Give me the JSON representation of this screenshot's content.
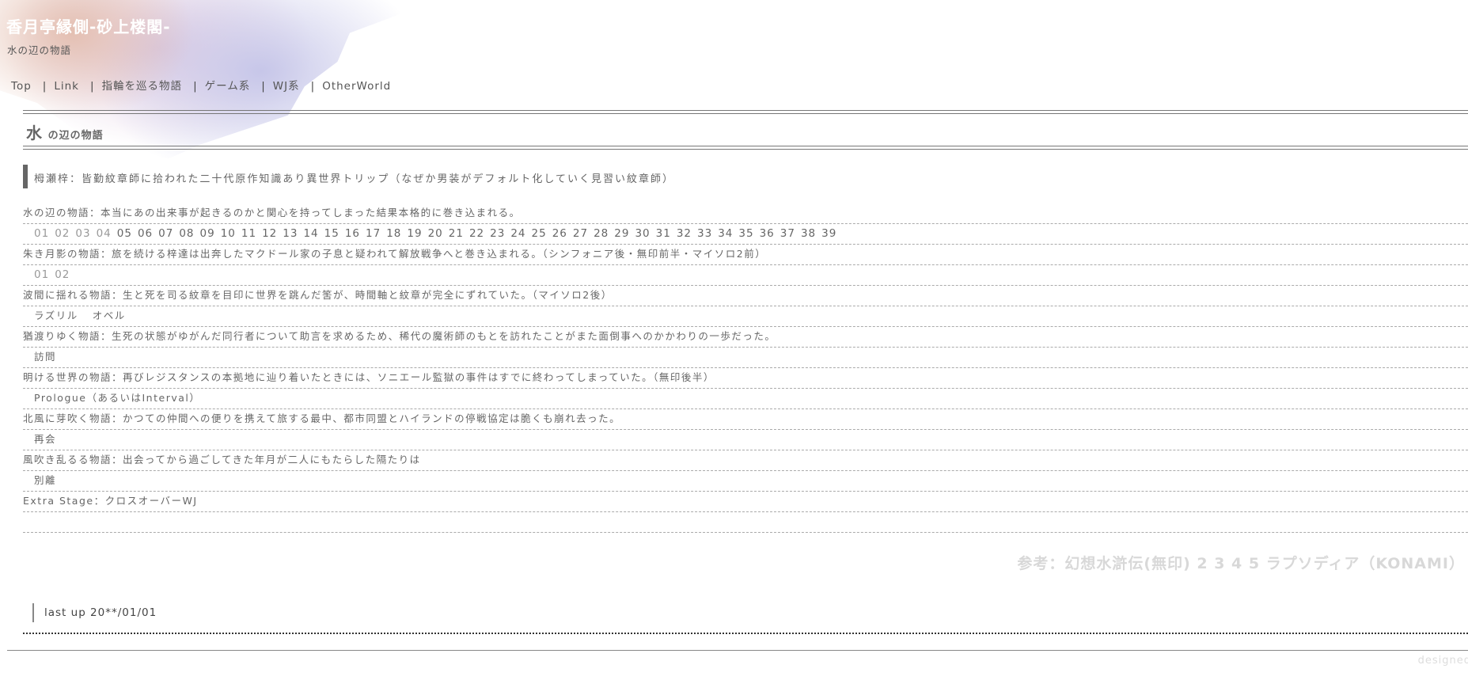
{
  "site": {
    "title": "香月亭縁側-砂上楼閣-",
    "subtitle": "水の辺の物語"
  },
  "nav": [
    {
      "label": "Top",
      "name": "nav-top"
    },
    {
      "label": "Link",
      "name": "nav-link"
    },
    {
      "label": "指輪を巡る物語",
      "name": "nav-ring-story"
    },
    {
      "label": "ゲーム系",
      "name": "nav-game"
    },
    {
      "label": "WJ系",
      "name": "nav-wj"
    },
    {
      "label": "OtherWorld",
      "name": "nav-otherworld"
    }
  ],
  "section": {
    "title_big": "水",
    "title_small": "の辺の物語"
  },
  "quote": "栂瀬梓：皆勤紋章師に拾われた二十代原作知識あり異世界トリップ（なぜか男装がデフォルト化していく見習い紋章師）",
  "stories": [
    {
      "desc": "水の辺の物語：本当にあの出来事が起きるのかと関心を持ってしまった結果本格的に巻き込まれる。",
      "type": "numbers",
      "faded": [
        "01",
        "02",
        "03",
        "04"
      ],
      "items": [
        "05",
        "06",
        "07",
        "08",
        "09",
        "10",
        "11",
        "12",
        "13",
        "14",
        "15",
        "16",
        "17",
        "18",
        "19",
        "20",
        "21",
        "22",
        "23",
        "24",
        "25",
        "26",
        "27",
        "28",
        "29",
        "30",
        "31",
        "32",
        "33",
        "34",
        "35",
        "36",
        "37",
        "38",
        "39"
      ]
    },
    {
      "desc": "朱き月影の物語：旅を続ける梓達は出奔したマクドール家の子息と疑われて解放戦争へと巻き込まれる。（シンフォニア後・無印前半・マイソロ2前）",
      "type": "numbers",
      "faded": [],
      "items": [
        "01",
        "02"
      ]
    },
    {
      "desc": "波間に揺れる物語：生と死を司る紋章を目印に世界を跳んだ筈が、時間軸と紋章が完全にずれていた。（マイソロ2後）",
      "type": "text",
      "items": [
        "ラズリル",
        "オベル"
      ]
    },
    {
      "desc": "猶渡りゆく物語：生死の状態がゆがんだ同行者について助言を求めるため、稀代の魔術師のもとを訪れたことがまた面倒事へのかかわりの一歩だった。",
      "type": "text",
      "items": [
        "訪問"
      ]
    },
    {
      "desc": "明ける世界の物語：再びレジスタンスの本拠地に辿り着いたときには、ソニエール監獄の事件はすでに終わってしまっていた。（無印後半）",
      "type": "text",
      "items": [
        "Prologue（あるいはInterval）"
      ]
    },
    {
      "desc": "北風に芽吹く物語：かつての仲間への便りを携えて旅する最中、都市同盟とハイランドの停戦協定は脆くも崩れ去った。",
      "type": "text",
      "items": [
        "再会"
      ]
    },
    {
      "desc": "風吹き乱るる物語：出会ってから過ごしてきた年月が二人にもたらした隔たりは",
      "type": "text",
      "items": [
        "別離"
      ]
    }
  ],
  "extra": "Extra Stage：クロスオーバーWJ",
  "reference": "参考：幻想水滸伝(無印) 2 3 4 5 ラプソディア（KONAMI）",
  "last_update": "last up 20**/01/01",
  "footer_credit": "designed"
}
